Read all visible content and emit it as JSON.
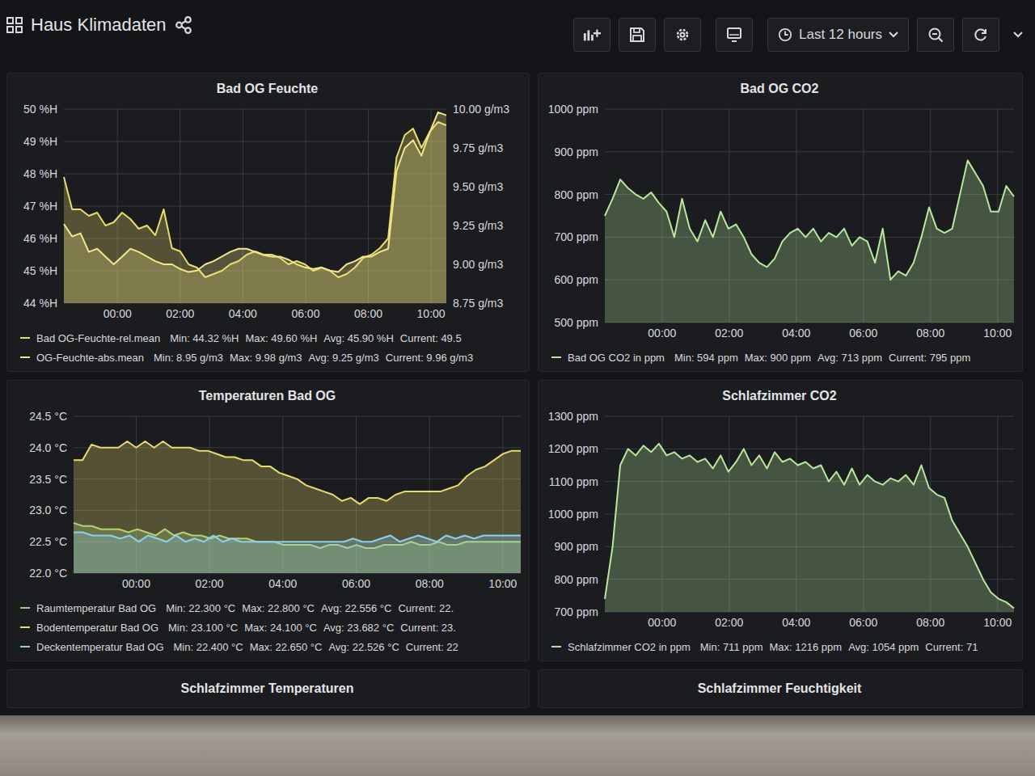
{
  "window": {
    "title": "Haus Klimadaten"
  },
  "toolbar": {
    "time_range": "Last 12 hours"
  },
  "panels": [
    {
      "title": "Bad OG Feuchte",
      "y_ticks": [
        "50 %H",
        "49 %H",
        "48 %H",
        "47 %H",
        "46 %H",
        "45 %H",
        "44 %H"
      ],
      "y2_ticks": [
        "10.00 g/m3",
        "9.75 g/m3",
        "9.50 g/m3",
        "9.25 g/m3",
        "9.00 g/m3",
        "8.75 g/m3"
      ],
      "x_ticks": [
        "00:00",
        "02:00",
        "04:00",
        "06:00",
        "08:00",
        "10:00"
      ],
      "series": [
        {
          "name": "Bad OG-Feuchte-rel.mean",
          "stats": [
            "Min: 44.32 %H",
            "Max: 49.60 %H",
            "Avg: 45.90 %H",
            "Current: 49.5"
          ],
          "color": "#e8dc6a",
          "y_axis": "left",
          "values": [
            47.9,
            46.9,
            46.9,
            46.7,
            46.8,
            46.4,
            46.5,
            46.8,
            46.6,
            46.3,
            46.4,
            46.1,
            46.9,
            45.7,
            45.6,
            45.2,
            45.1,
            44.8,
            44.9,
            45.0,
            45.2,
            45.3,
            45.5,
            45.6,
            45.5,
            45.5,
            45.4,
            45.2,
            45.3,
            45.2,
            45.0,
            45.1,
            45.0,
            44.8,
            44.9,
            45.1,
            45.4,
            45.5,
            45.7,
            46.0,
            48.5,
            49.2,
            49.4,
            48.8,
            49.3,
            49.6,
            49.5
          ]
        },
        {
          "name": "OG-Feuchte-abs.mean",
          "stats": [
            "Min: 8.95 g/m3",
            "Max: 9.98 g/m3",
            "Avg: 9.25 g/m3",
            "Current: 9.96 g/m3"
          ],
          "color": "#f2e58a",
          "y_axis": "right",
          "values": [
            9.26,
            9.18,
            9.2,
            9.08,
            9.1,
            9.05,
            9.0,
            9.05,
            9.1,
            9.08,
            9.05,
            9.02,
            9.0,
            9.0,
            8.97,
            8.95,
            8.96,
            9.0,
            9.02,
            9.05,
            9.08,
            9.1,
            9.1,
            9.08,
            9.06,
            9.05,
            9.05,
            9.03,
            9.0,
            8.98,
            8.97,
            8.98,
            8.96,
            8.95,
            9.0,
            9.02,
            9.05,
            9.05,
            9.08,
            9.1,
            9.6,
            9.75,
            9.8,
            9.7,
            9.85,
            9.98,
            9.96
          ]
        }
      ]
    },
    {
      "title": "Bad OG CO2",
      "y_ticks": [
        "1000 ppm",
        "900 ppm",
        "800 ppm",
        "700 ppm",
        "600 ppm",
        "500 ppm"
      ],
      "y2_ticks": [],
      "x_ticks": [
        "00:00",
        "02:00",
        "04:00",
        "06:00",
        "08:00",
        "10:00"
      ],
      "series": [
        {
          "name": "Bad OG CO2 in ppm",
          "stats": [
            "Min: 594 ppm",
            "Max: 900 ppm",
            "Avg: 713 ppm",
            "Current: 795 ppm"
          ],
          "color": "#b8e89c",
          "y_axis": "left",
          "values": [
            750,
            790,
            835,
            815,
            800,
            790,
            805,
            780,
            760,
            700,
            790,
            720,
            690,
            740,
            700,
            760,
            720,
            730,
            700,
            660,
            640,
            630,
            650,
            690,
            710,
            720,
            700,
            720,
            690,
            710,
            700,
            720,
            680,
            700,
            690,
            640,
            720,
            600,
            620,
            610,
            640,
            700,
            770,
            720,
            710,
            720,
            800,
            880,
            850,
            820,
            760,
            760,
            820,
            795
          ]
        }
      ]
    },
    {
      "title": "Temperaturen Bad OG",
      "y_ticks": [
        "24.5 °C",
        "24.0 °C",
        "23.5 °C",
        "23.0 °C",
        "22.5 °C",
        "22.0 °C"
      ],
      "y2_ticks": [],
      "x_ticks": [
        "00:00",
        "02:00",
        "04:00",
        "06:00",
        "08:00",
        "10:00"
      ],
      "series": [
        {
          "name": "Raumtemperatur Bad OG",
          "stats": [
            "Min: 22.300 °C",
            "Max: 22.800 °C",
            "Avg: 22.556 °C",
            "Current: 22."
          ],
          "color": "#9ccf7a",
          "y_axis": "left",
          "values": [
            22.8,
            22.75,
            22.75,
            22.7,
            22.7,
            22.7,
            22.65,
            22.7,
            22.65,
            22.6,
            22.7,
            22.6,
            22.65,
            22.6,
            22.6,
            22.55,
            22.6,
            22.55,
            22.55,
            22.55,
            22.5,
            22.5,
            22.5,
            22.45,
            22.45,
            22.45,
            22.45,
            22.4,
            22.45,
            22.45,
            22.4,
            22.45,
            22.4,
            22.4,
            22.45,
            22.45,
            22.45,
            22.5,
            22.45,
            22.45,
            22.5,
            22.45,
            22.45,
            22.5,
            22.5,
            22.5,
            22.5,
            22.5,
            22.5,
            22.5
          ]
        },
        {
          "name": "Bodentemperatur Bad OG",
          "stats": [
            "Min: 23.100 °C",
            "Max: 24.100 °C",
            "Avg: 23.682 °C",
            "Current: 23."
          ],
          "color": "#e8dc6a",
          "y_axis": "left",
          "values": [
            23.8,
            23.8,
            24.05,
            24.0,
            24.0,
            24.0,
            24.1,
            24.0,
            24.1,
            24.0,
            24.1,
            24.0,
            24.0,
            24.0,
            23.95,
            23.95,
            23.9,
            23.85,
            23.85,
            23.8,
            23.8,
            23.7,
            23.7,
            23.6,
            23.55,
            23.5,
            23.4,
            23.35,
            23.3,
            23.25,
            23.15,
            23.2,
            23.1,
            23.2,
            23.2,
            23.15,
            23.25,
            23.3,
            23.3,
            23.3,
            23.3,
            23.3,
            23.35,
            23.4,
            23.55,
            23.65,
            23.7,
            23.8,
            23.9,
            23.95,
            23.95
          ]
        },
        {
          "name": "Deckentemperatur Bad OG",
          "stats": [
            "Min: 22.400 °C",
            "Max: 22.650 °C",
            "Avg: 22.526 °C",
            "Current: 22"
          ],
          "color": "#8ad0f0",
          "y_axis": "left",
          "values": [
            22.65,
            22.65,
            22.6,
            22.6,
            22.6,
            22.55,
            22.6,
            22.5,
            22.6,
            22.55,
            22.5,
            22.6,
            22.5,
            22.55,
            22.5,
            22.6,
            22.5,
            22.55,
            22.5,
            22.5,
            22.5,
            22.5,
            22.5,
            22.5,
            22.5,
            22.5,
            22.5,
            22.5,
            22.5,
            22.5,
            22.55,
            22.5,
            22.5,
            22.55,
            22.6,
            22.5,
            22.55,
            22.6,
            22.55,
            22.5,
            22.6,
            22.55,
            22.6,
            22.55,
            22.6,
            22.6,
            22.6,
            22.6,
            22.6
          ]
        }
      ]
    },
    {
      "title": "Schlafzimmer CO2",
      "y_ticks": [
        "1300 ppm",
        "1200 ppm",
        "1100 ppm",
        "1000 ppm",
        "900 ppm",
        "800 ppm",
        "700 ppm"
      ],
      "y2_ticks": [],
      "x_ticks": [
        "00:00",
        "02:00",
        "04:00",
        "06:00",
        "08:00",
        "10:00"
      ],
      "series": [
        {
          "name": "Schlafzimmer CO2 in ppm",
          "stats": [
            "Min: 711 ppm",
            "Max: 1216 ppm",
            "Avg: 1054 ppm",
            "Current: 71"
          ],
          "color": "#b8e89c",
          "y_axis": "left",
          "values": [
            740,
            900,
            1150,
            1200,
            1180,
            1210,
            1190,
            1216,
            1180,
            1190,
            1170,
            1180,
            1160,
            1170,
            1140,
            1180,
            1130,
            1160,
            1200,
            1150,
            1180,
            1140,
            1190,
            1160,
            1170,
            1150,
            1160,
            1140,
            1150,
            1100,
            1130,
            1090,
            1140,
            1090,
            1120,
            1100,
            1090,
            1110,
            1100,
            1120,
            1090,
            1150,
            1080,
            1060,
            1050,
            980,
            940,
            900,
            850,
            800,
            760,
            740,
            730,
            711
          ]
        }
      ]
    }
  ],
  "bottom_panels": [
    {
      "title": "Schlafzimmer Temperaturen"
    },
    {
      "title": "Schlafzimmer Feuchtigkeit"
    }
  ]
}
